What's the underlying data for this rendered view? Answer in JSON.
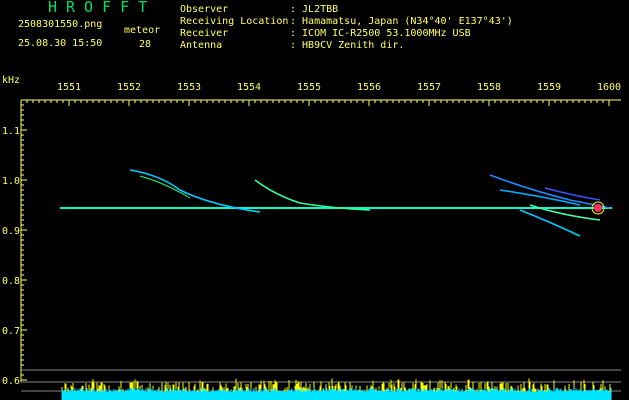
{
  "header": {
    "title": "HROFFT",
    "filename": "2508301550.png",
    "datetime": "25.08.30 15:50",
    "meteor_label": "meteor",
    "meteor_count": "28"
  },
  "info": [
    {
      "key": "Observer",
      "value": ": JL2TBB"
    },
    {
      "key": "Receiving Location",
      "value": ": Hamamatsu, Japan (N34°40' E137°43')"
    },
    {
      "key": "Receiver",
      "value": ": ICOM IC-R2500 53.1000MHz USB"
    },
    {
      "key": "Antenna",
      "value": ": HB9CV Zenith dir."
    }
  ],
  "axis": {
    "unit": "kHz",
    "x_ticks": [
      "1551",
      "1552",
      "1553",
      "1554",
      "1555",
      "1556",
      "1557",
      "1558",
      "1559",
      "1600"
    ],
    "y_ticks": [
      "1.1",
      "1.0",
      "0.9",
      "0.8",
      "0.7",
      "0.6"
    ]
  },
  "colors": {
    "text": "#ffff66",
    "title": "#00e060",
    "carrier": "#00ffcc",
    "spectrum": "#00e5ff",
    "spectrum_peaks": "#ffff00"
  }
}
